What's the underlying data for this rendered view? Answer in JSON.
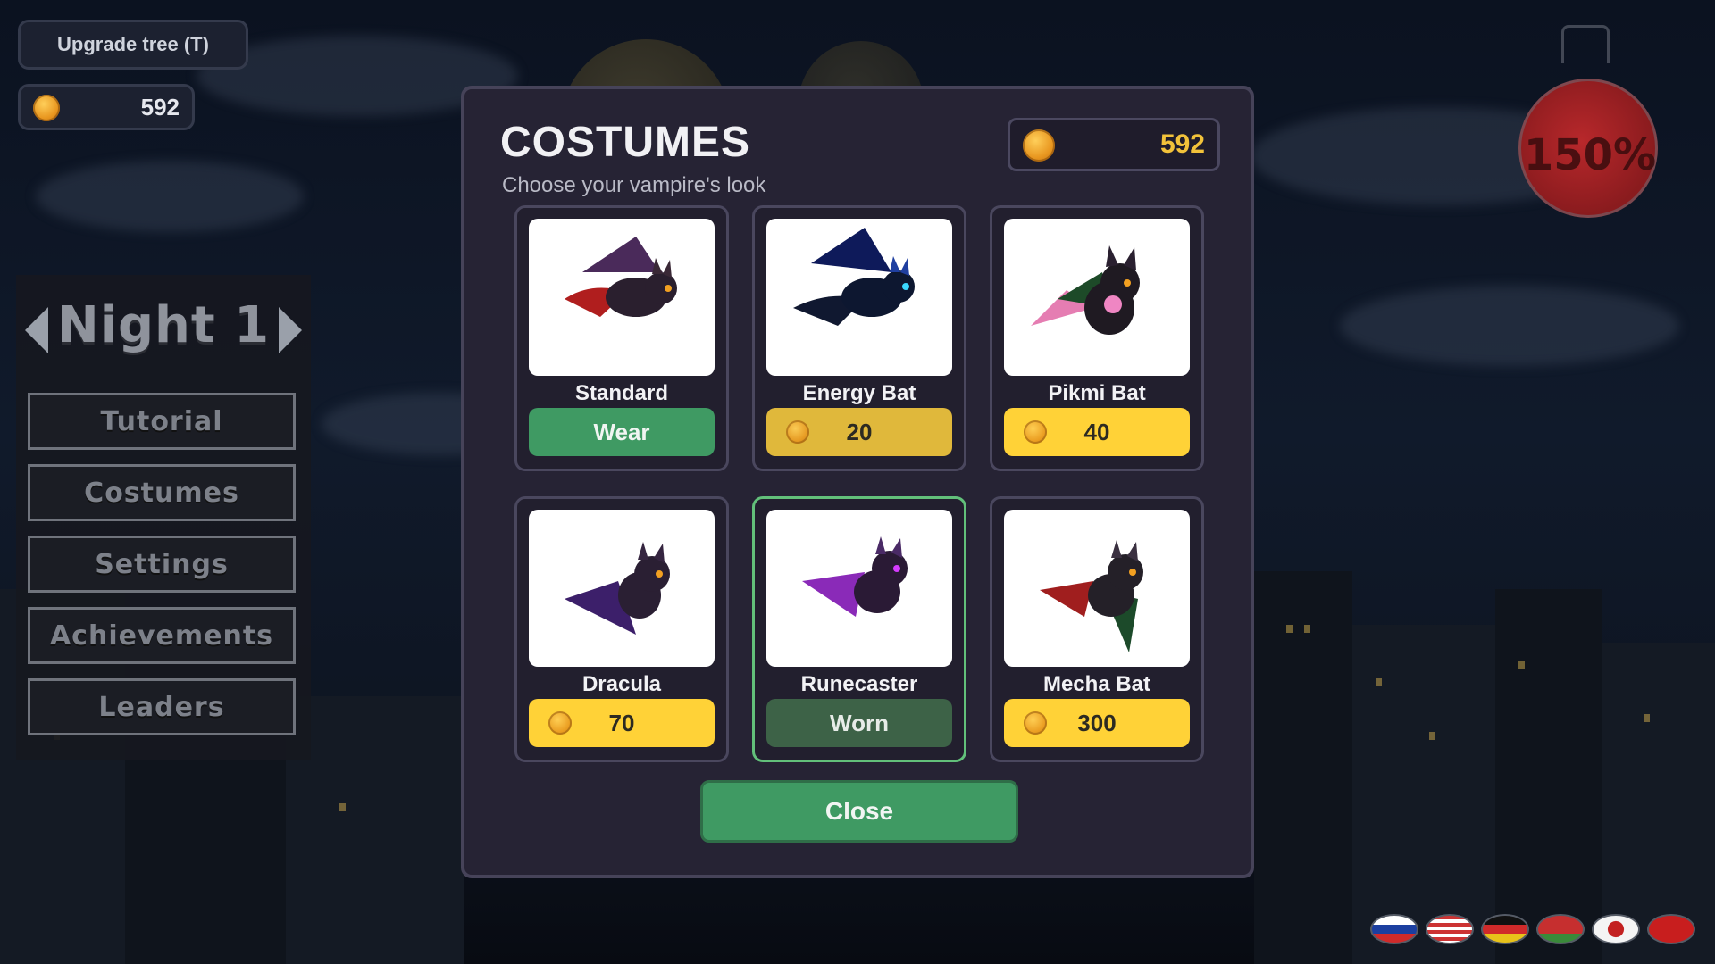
{
  "hud": {
    "upgrade_label": "Upgrade tree (T)",
    "coins": "592",
    "potion_percent": "150%"
  },
  "menu": {
    "night_label": "Night 1",
    "items": [
      {
        "label": "Tutorial"
      },
      {
        "label": "Costumes"
      },
      {
        "label": "Settings"
      },
      {
        "label": "Achievements"
      },
      {
        "label": "Leaders"
      }
    ]
  },
  "dialog": {
    "title": "COSTUMES",
    "subtitle": "Choose your vampire's look",
    "coins": "592",
    "close_label": "Close",
    "costumes": [
      {
        "name": "Standard",
        "action": "Wear",
        "state": "wear",
        "icon": "bat-standard-icon",
        "color": "#6b1d24"
      },
      {
        "name": "Energy Bat",
        "price": "20",
        "state": "buy",
        "icon": "bat-energy-icon",
        "color": "#1b2a7a"
      },
      {
        "name": "Pikmi Bat",
        "price": "40",
        "state": "buy",
        "icon": "bat-pikmi-icon",
        "color": "#e47fb6"
      },
      {
        "name": "Dracula",
        "price": "70",
        "state": "buy",
        "icon": "bat-dracula-icon",
        "color": "#4b2a7a"
      },
      {
        "name": "Runecaster",
        "action": "Worn",
        "state": "worn",
        "icon": "bat-runecaster-icon",
        "color": "#7a2aa0"
      },
      {
        "name": "Mecha Bat",
        "price": "300",
        "state": "buy",
        "icon": "bat-mecha-icon",
        "color": "#1f5a2f"
      }
    ]
  },
  "flags": [
    "russia-flag-icon",
    "usa-flag-icon",
    "germany-flag-icon",
    "belarus-flag-icon",
    "japan-flag-icon",
    "china-flag-icon"
  ],
  "colors": {
    "accent_green": "#3f9a63",
    "coin_gold": "#f2c23a",
    "buy_yellow": "#ffd237",
    "selected_border": "#62c07a"
  }
}
